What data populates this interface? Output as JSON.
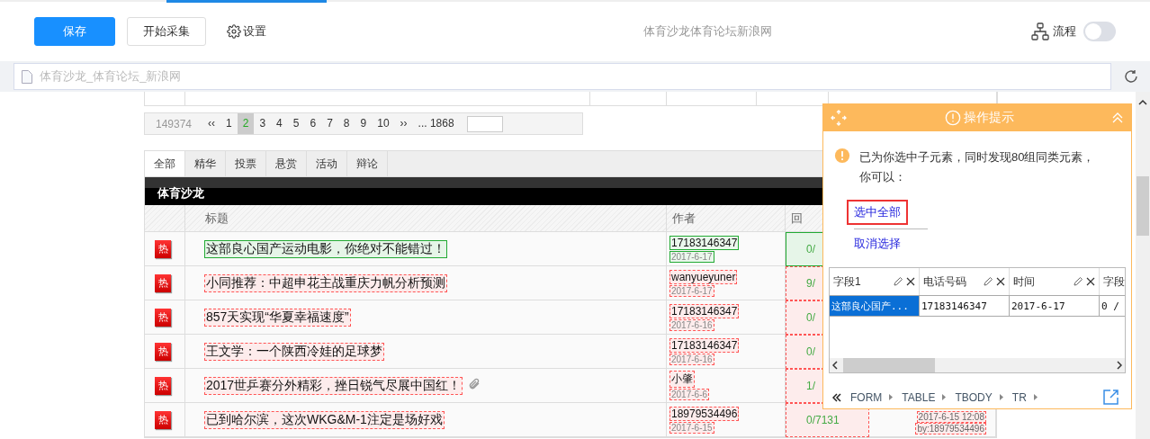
{
  "toolbar": {
    "buttons": [
      {
        "label": "保存",
        "kind": "primary"
      },
      {
        "label": "开始采集",
        "kind": "default"
      }
    ],
    "settings": "设置",
    "page_title": "体育沙龙体育论坛新浪网",
    "flow": {
      "label": "流程",
      "on": false
    }
  },
  "address_bar": {
    "value": "体育沙龙_体育论坛_新浪网"
  },
  "forum": {
    "pagination": {
      "total": "149374",
      "pages": [
        {
          "label": "‹‹",
          "selected": false
        },
        {
          "label": "1",
          "selected": false
        },
        {
          "label": "2",
          "selected": true
        },
        {
          "label": "3",
          "selected": false
        },
        {
          "label": "4",
          "selected": false
        },
        {
          "label": "5",
          "selected": false
        },
        {
          "label": "6",
          "selected": false
        },
        {
          "label": "7",
          "selected": false
        },
        {
          "label": "8",
          "selected": false
        },
        {
          "label": "9",
          "selected": false
        },
        {
          "label": "10",
          "selected": false
        },
        {
          "label": "››",
          "selected": false
        },
        {
          "label": "... 1868",
          "selected": false
        }
      ]
    },
    "tabs": [
      {
        "label": "全部",
        "selected": true
      },
      {
        "label": "精华",
        "selected": false
      },
      {
        "label": "投票",
        "selected": false
      },
      {
        "label": "悬赏",
        "selected": false
      },
      {
        "label": "活动",
        "selected": false
      },
      {
        "label": "辩论",
        "selected": false
      }
    ],
    "section_title": "体育沙龙",
    "columns": [
      "标题",
      "作者",
      "回"
    ],
    "rows": [
      {
        "badge": "热",
        "title": "这部良心国产运动电影，你绝对不能错过！",
        "author": "17183146347",
        "date": "2017-6-17",
        "replies": "0/",
        "selected": true,
        "attachment": false
      },
      {
        "badge": "热",
        "title": "小同推荐：中超申花主战重庆力帆分析预测",
        "author": "wanyueyuner",
        "date": "2017-6-17",
        "replies": "9/",
        "selected": false,
        "attachment": false
      },
      {
        "badge": "热",
        "title": "857天实现“华夏幸福速度”",
        "author": "17183146347",
        "date": "2017-6-16",
        "replies": "0/",
        "selected": false,
        "attachment": false
      },
      {
        "badge": "热",
        "title": "王文学：一个陕西冷娃的足球梦",
        "author": "17183146347",
        "date": "2017-6-16",
        "replies": "0/",
        "selected": false,
        "attachment": false
      },
      {
        "badge": "热",
        "title": "2017世乒赛分外精彩，挫日锐气尽展中国红！",
        "author": "小肇",
        "date": "2017-6-6",
        "replies": "1/",
        "selected": false,
        "attachment": true
      },
      {
        "badge": "热",
        "title": "已到哈尔滨，这次WKG&M-1注定是场好戏",
        "author": "18979534496",
        "date": "2017-6-15",
        "replies": "0/7131",
        "selected": false,
        "attachment": false,
        "last_post": {
          "time": "2017-6-15 12:08",
          "by": "by:18979534496"
        }
      }
    ]
  },
  "hint_panel": {
    "title": "操作提示",
    "message": "已为你选中子元素，同时发现80组同类元素，你可以：",
    "actions": [
      {
        "label": "选中全部",
        "highlighted": true
      },
      {
        "label": "取消选择",
        "highlighted": false
      }
    ],
    "preview": {
      "columns": [
        {
          "label": "字段1",
          "editable": true
        },
        {
          "label": "电话号码",
          "editable": true
        },
        {
          "label": "时间",
          "editable": true
        },
        {
          "label": "字段"
        }
      ],
      "rows": [
        [
          {
            "text": "这部良心国产...",
            "selected": true
          },
          {
            "text": "17183146347",
            "selected": false
          },
          {
            "text": "2017-6-17",
            "selected": false
          },
          {
            "text": "0 /",
            "selected": false
          }
        ]
      ]
    },
    "breadcrumb": [
      "FORM",
      "TABLE",
      "TBODY",
      "TR"
    ]
  }
}
